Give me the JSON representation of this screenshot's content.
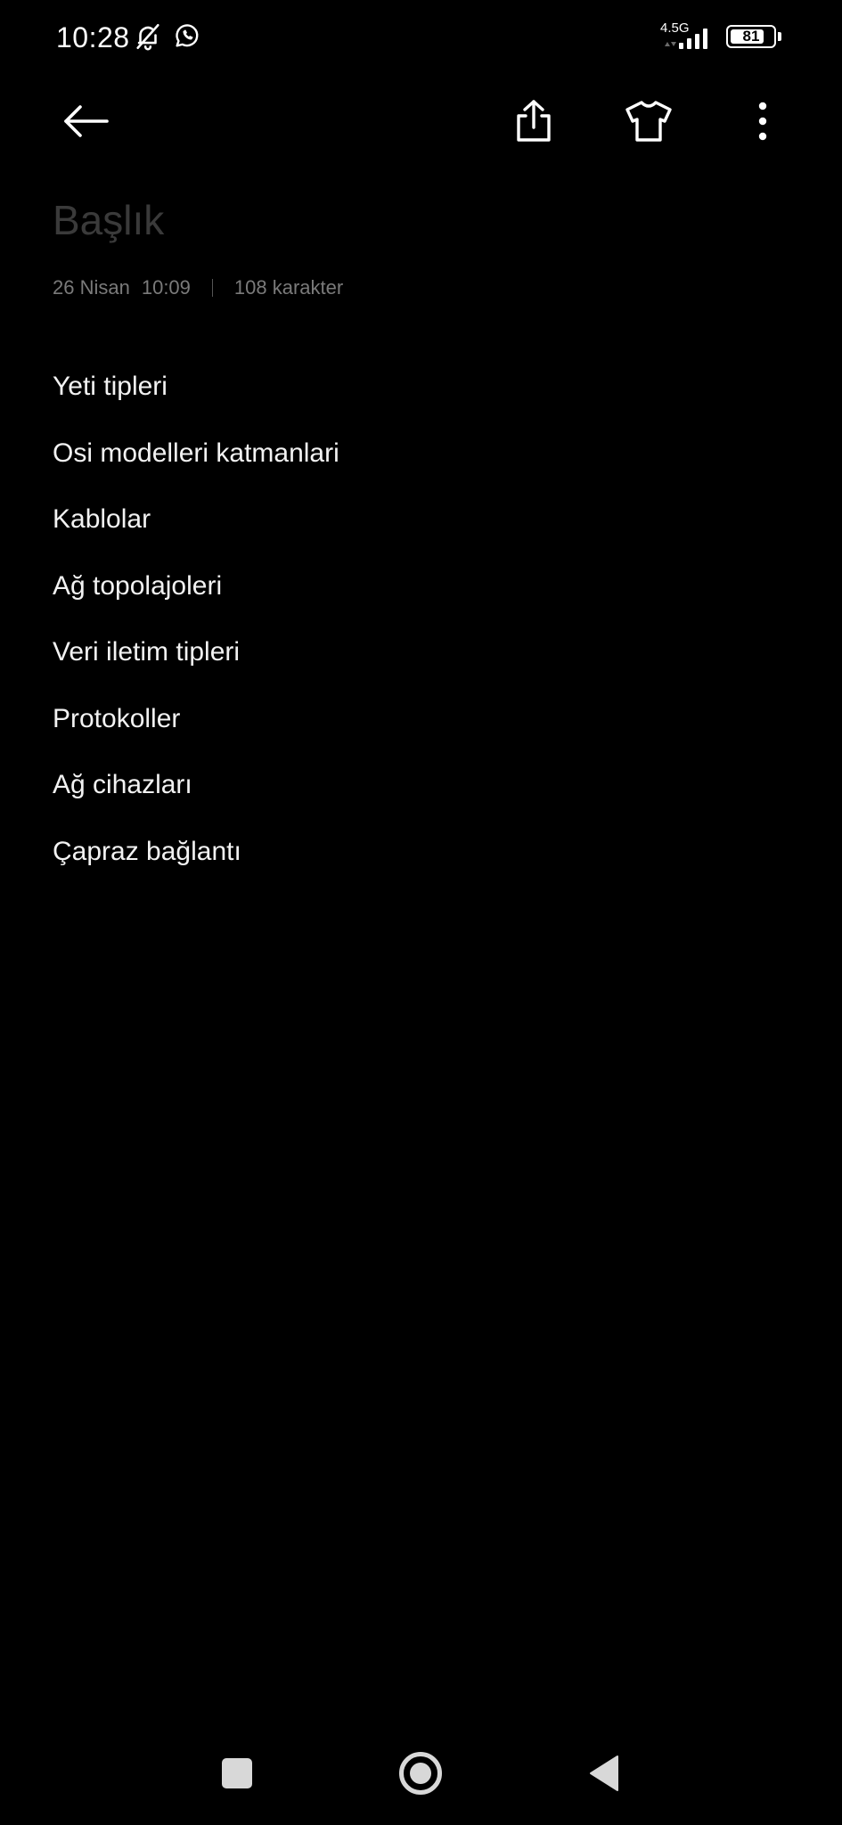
{
  "status_bar": {
    "time": "10:28",
    "network_type": "4.5G",
    "battery_level": "81",
    "icons": [
      "bell-off-icon",
      "whatsapp-icon",
      "signal-icon",
      "battery-icon"
    ]
  },
  "toolbar": {
    "icons": [
      "arrow-left-icon",
      "share-icon",
      "tshirt-icon",
      "more-vertical-icon"
    ]
  },
  "note": {
    "title_placeholder": "Başlık",
    "date": "26 Nisan",
    "time": "10:09",
    "char_count": "108 karakter",
    "lines": [
      "Yeti tipleri",
      "Osi modelleri katmanlari",
      "Kablolar",
      "Ağ topolajoleri",
      "Veri iletim tipleri",
      "Protokoller",
      "Ağ cihazları",
      "Çapraz bağlantı"
    ]
  },
  "nav_bar": {
    "icons": [
      "recents-square-icon",
      "home-circle-icon",
      "back-triangle-icon"
    ]
  },
  "colors": {
    "background": "#000000",
    "text_primary": "#f2f2f2",
    "text_meta": "#7a7a7a",
    "title_placeholder": "#3a3a3a"
  }
}
